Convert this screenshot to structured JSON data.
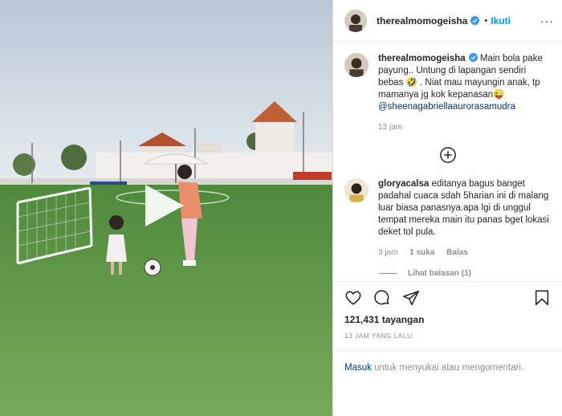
{
  "post": {
    "username": "therealmomogeisha",
    "follow_label": "Ikuti",
    "dot": "•",
    "more_label": "···"
  },
  "caption": {
    "username": "therealmomogeisha",
    "text_1": " Main bola pake payung.. Untung di lapangan sendiri bebas 🤣 . Niat mau mayungin anak, tp mamanya jg kok kepanasan😜 ",
    "mention": "@sheenagabriellaaurorasamudra",
    "time": "13 jam"
  },
  "comment": {
    "username": "gloryacalsa",
    "text": " editanya bagus banget padahal cuaca sdah 5harian ini di malang luar biasa panasnya.apa lgi di unggul tempat mereka main itu panas bget lokasi deket tol pula.",
    "time": "3 jam",
    "likes": "1 suka",
    "reply": "Balas",
    "view_replies": "Lihat balasan (1)"
  },
  "stats": {
    "views": "121,431 tayangan",
    "posted": "13 JAM YANG LALU"
  },
  "login": {
    "link": "Masuk",
    "text": " untuk menyukai atau mengomentari."
  },
  "icons": [
    "verified-badge-icon",
    "heart-icon",
    "comment-icon",
    "share-icon",
    "bookmark-icon",
    "add-circle-icon",
    "play-icon"
  ],
  "colors": {
    "link_blue": "#0095f6",
    "mention": "#00376b",
    "muted": "#8e8e8e",
    "grass": "#6f9a4f"
  }
}
